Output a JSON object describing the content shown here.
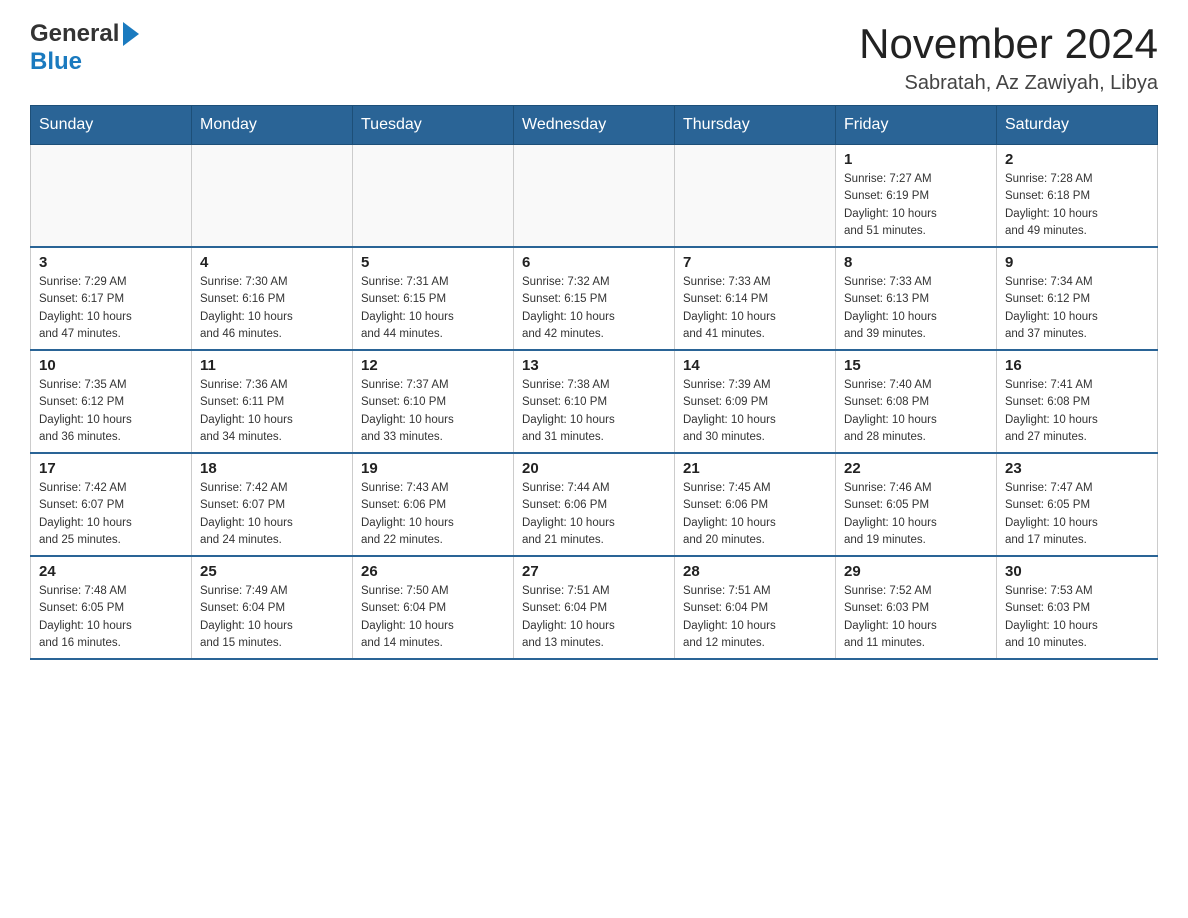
{
  "header": {
    "logo_general": "General",
    "logo_blue": "Blue",
    "title": "November 2024",
    "subtitle": "Sabratah, Az Zawiyah, Libya"
  },
  "weekdays": [
    "Sunday",
    "Monday",
    "Tuesday",
    "Wednesday",
    "Thursday",
    "Friday",
    "Saturday"
  ],
  "weeks": [
    [
      {
        "day": "",
        "info": ""
      },
      {
        "day": "",
        "info": ""
      },
      {
        "day": "",
        "info": ""
      },
      {
        "day": "",
        "info": ""
      },
      {
        "day": "",
        "info": ""
      },
      {
        "day": "1",
        "info": "Sunrise: 7:27 AM\nSunset: 6:19 PM\nDaylight: 10 hours\nand 51 minutes."
      },
      {
        "day": "2",
        "info": "Sunrise: 7:28 AM\nSunset: 6:18 PM\nDaylight: 10 hours\nand 49 minutes."
      }
    ],
    [
      {
        "day": "3",
        "info": "Sunrise: 7:29 AM\nSunset: 6:17 PM\nDaylight: 10 hours\nand 47 minutes."
      },
      {
        "day": "4",
        "info": "Sunrise: 7:30 AM\nSunset: 6:16 PM\nDaylight: 10 hours\nand 46 minutes."
      },
      {
        "day": "5",
        "info": "Sunrise: 7:31 AM\nSunset: 6:15 PM\nDaylight: 10 hours\nand 44 minutes."
      },
      {
        "day": "6",
        "info": "Sunrise: 7:32 AM\nSunset: 6:15 PM\nDaylight: 10 hours\nand 42 minutes."
      },
      {
        "day": "7",
        "info": "Sunrise: 7:33 AM\nSunset: 6:14 PM\nDaylight: 10 hours\nand 41 minutes."
      },
      {
        "day": "8",
        "info": "Sunrise: 7:33 AM\nSunset: 6:13 PM\nDaylight: 10 hours\nand 39 minutes."
      },
      {
        "day": "9",
        "info": "Sunrise: 7:34 AM\nSunset: 6:12 PM\nDaylight: 10 hours\nand 37 minutes."
      }
    ],
    [
      {
        "day": "10",
        "info": "Sunrise: 7:35 AM\nSunset: 6:12 PM\nDaylight: 10 hours\nand 36 minutes."
      },
      {
        "day": "11",
        "info": "Sunrise: 7:36 AM\nSunset: 6:11 PM\nDaylight: 10 hours\nand 34 minutes."
      },
      {
        "day": "12",
        "info": "Sunrise: 7:37 AM\nSunset: 6:10 PM\nDaylight: 10 hours\nand 33 minutes."
      },
      {
        "day": "13",
        "info": "Sunrise: 7:38 AM\nSunset: 6:10 PM\nDaylight: 10 hours\nand 31 minutes."
      },
      {
        "day": "14",
        "info": "Sunrise: 7:39 AM\nSunset: 6:09 PM\nDaylight: 10 hours\nand 30 minutes."
      },
      {
        "day": "15",
        "info": "Sunrise: 7:40 AM\nSunset: 6:08 PM\nDaylight: 10 hours\nand 28 minutes."
      },
      {
        "day": "16",
        "info": "Sunrise: 7:41 AM\nSunset: 6:08 PM\nDaylight: 10 hours\nand 27 minutes."
      }
    ],
    [
      {
        "day": "17",
        "info": "Sunrise: 7:42 AM\nSunset: 6:07 PM\nDaylight: 10 hours\nand 25 minutes."
      },
      {
        "day": "18",
        "info": "Sunrise: 7:42 AM\nSunset: 6:07 PM\nDaylight: 10 hours\nand 24 minutes."
      },
      {
        "day": "19",
        "info": "Sunrise: 7:43 AM\nSunset: 6:06 PM\nDaylight: 10 hours\nand 22 minutes."
      },
      {
        "day": "20",
        "info": "Sunrise: 7:44 AM\nSunset: 6:06 PM\nDaylight: 10 hours\nand 21 minutes."
      },
      {
        "day": "21",
        "info": "Sunrise: 7:45 AM\nSunset: 6:06 PM\nDaylight: 10 hours\nand 20 minutes."
      },
      {
        "day": "22",
        "info": "Sunrise: 7:46 AM\nSunset: 6:05 PM\nDaylight: 10 hours\nand 19 minutes."
      },
      {
        "day": "23",
        "info": "Sunrise: 7:47 AM\nSunset: 6:05 PM\nDaylight: 10 hours\nand 17 minutes."
      }
    ],
    [
      {
        "day": "24",
        "info": "Sunrise: 7:48 AM\nSunset: 6:05 PM\nDaylight: 10 hours\nand 16 minutes."
      },
      {
        "day": "25",
        "info": "Sunrise: 7:49 AM\nSunset: 6:04 PM\nDaylight: 10 hours\nand 15 minutes."
      },
      {
        "day": "26",
        "info": "Sunrise: 7:50 AM\nSunset: 6:04 PM\nDaylight: 10 hours\nand 14 minutes."
      },
      {
        "day": "27",
        "info": "Sunrise: 7:51 AM\nSunset: 6:04 PM\nDaylight: 10 hours\nand 13 minutes."
      },
      {
        "day": "28",
        "info": "Sunrise: 7:51 AM\nSunset: 6:04 PM\nDaylight: 10 hours\nand 12 minutes."
      },
      {
        "day": "29",
        "info": "Sunrise: 7:52 AM\nSunset: 6:03 PM\nDaylight: 10 hours\nand 11 minutes."
      },
      {
        "day": "30",
        "info": "Sunrise: 7:53 AM\nSunset: 6:03 PM\nDaylight: 10 hours\nand 10 minutes."
      }
    ]
  ]
}
